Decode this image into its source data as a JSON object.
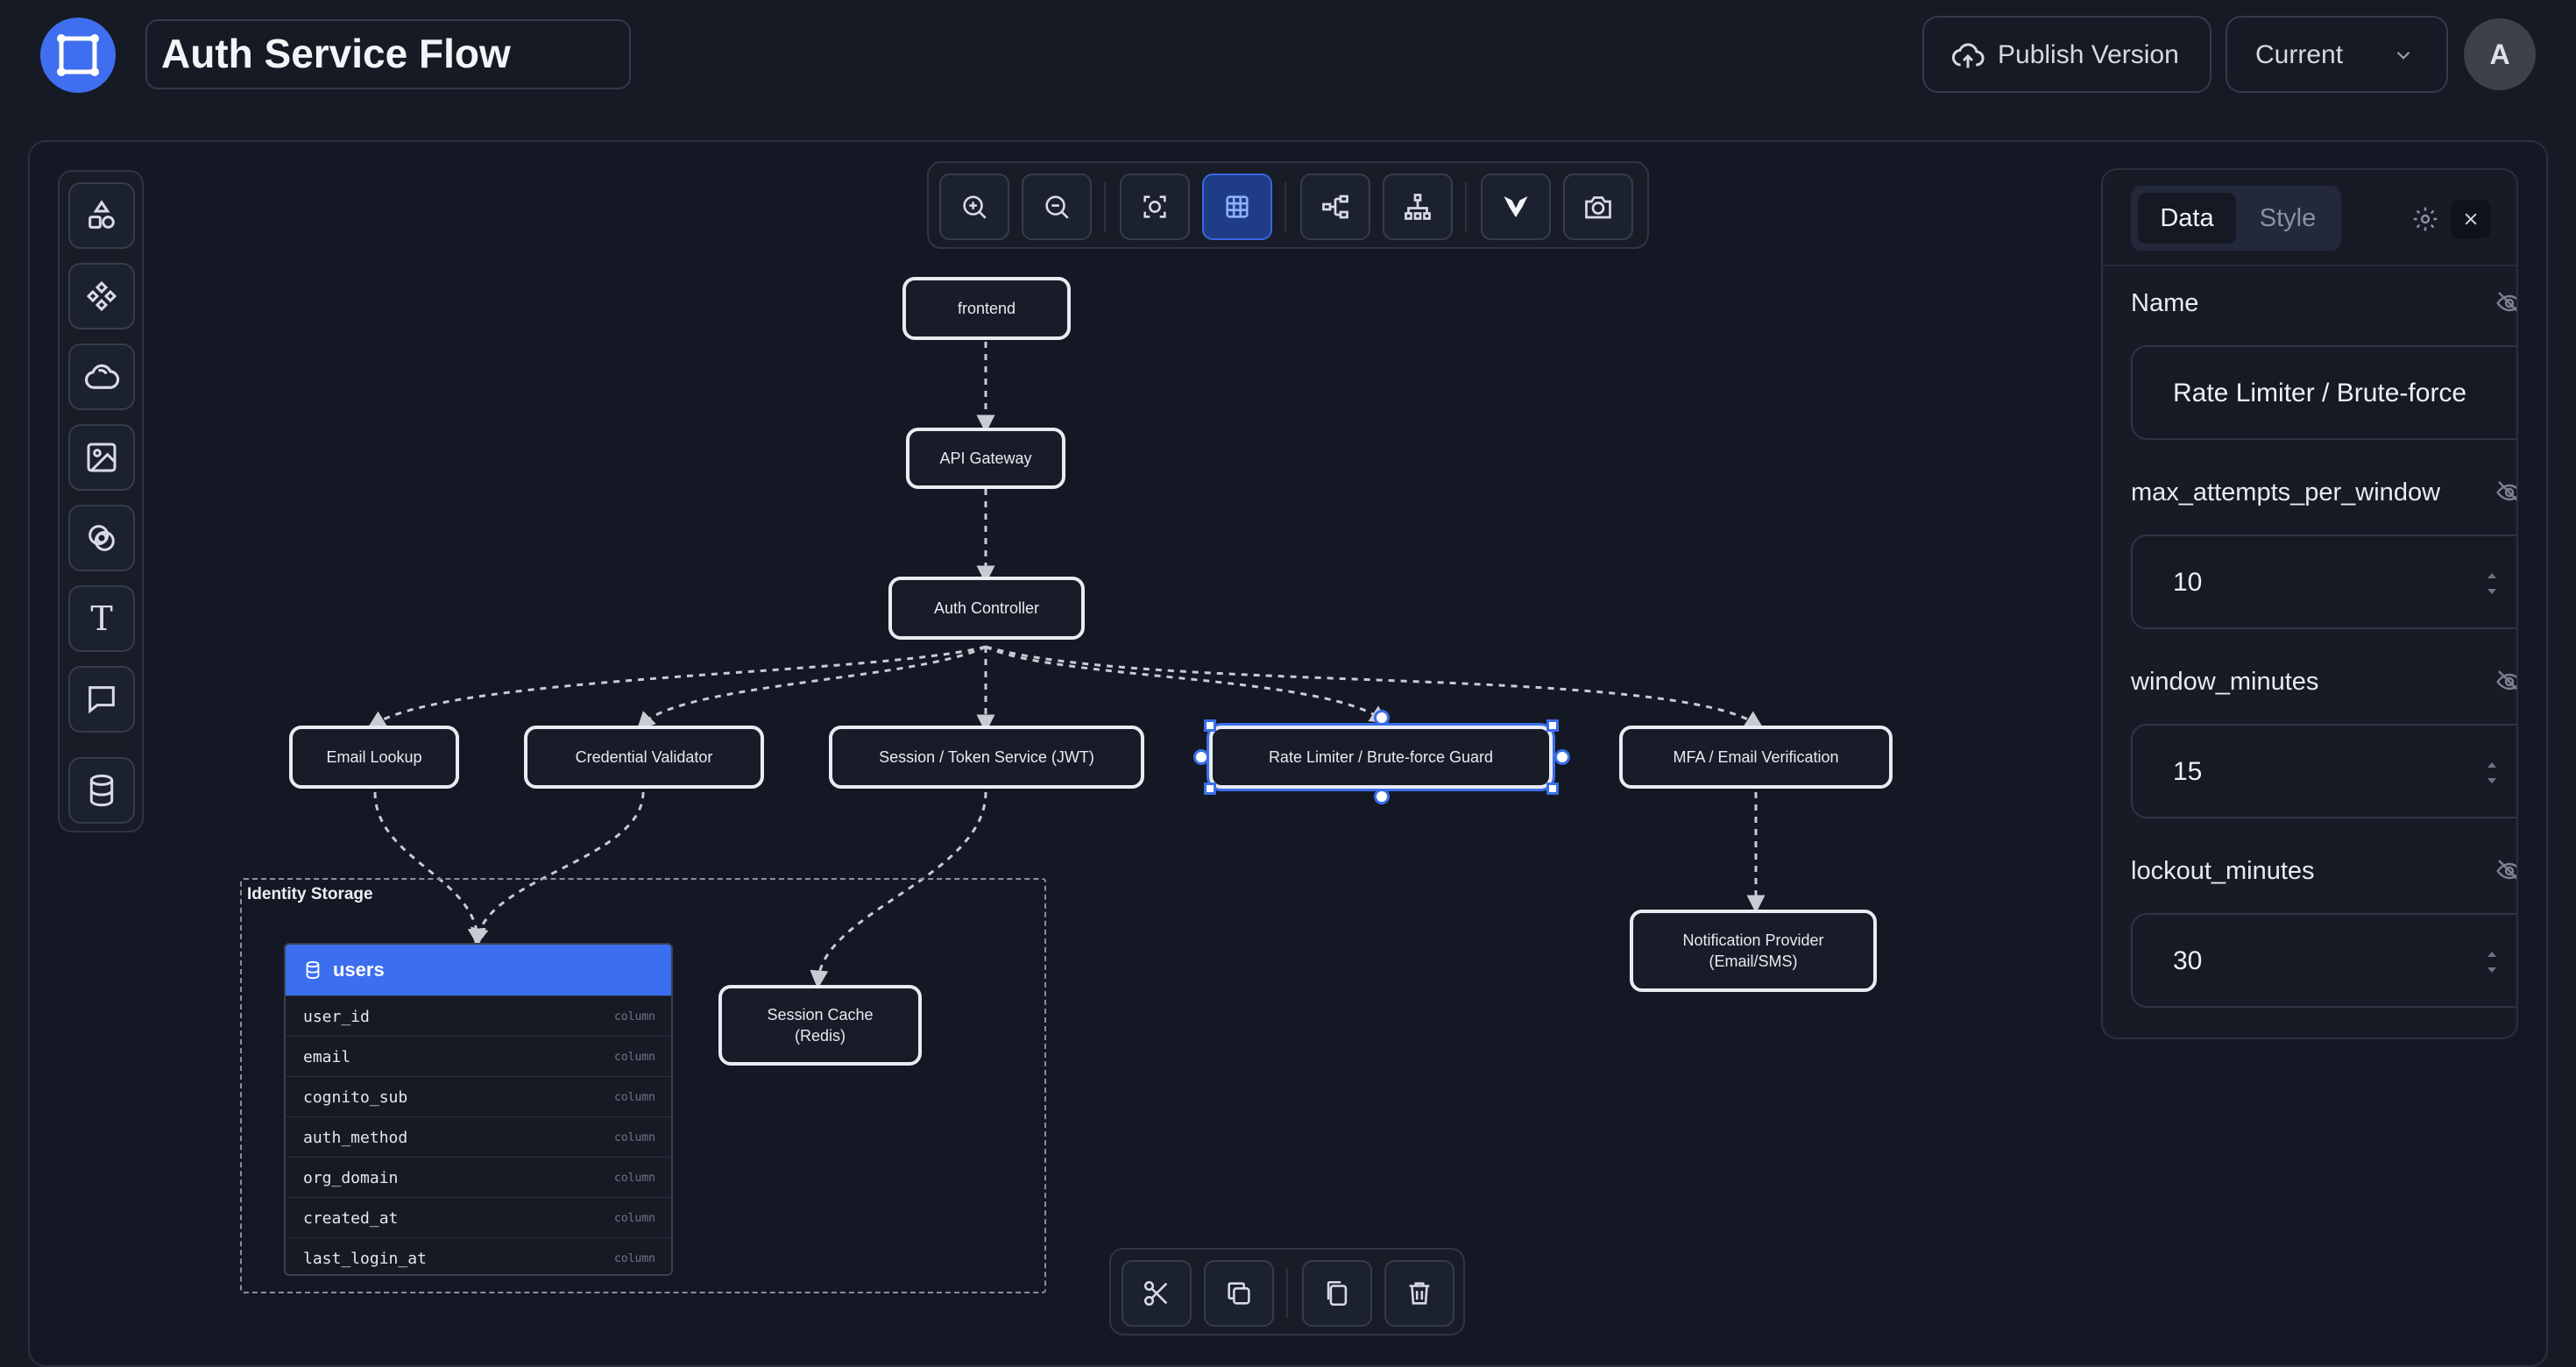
{
  "header": {
    "title": "Auth Service Flow",
    "publish_label": "Publish Version",
    "version_select": "Current",
    "avatar_initial": "A"
  },
  "left_toolbar": [
    {
      "icon": "shapes-icon"
    },
    {
      "icon": "components-icon"
    },
    {
      "icon": "cloud-icon"
    },
    {
      "icon": "image-icon"
    },
    {
      "icon": "link-icon"
    },
    {
      "icon": "text-icon",
      "glyph": "T"
    },
    {
      "icon": "comment-icon"
    },
    {
      "icon": "database-icon"
    }
  ],
  "top_toolbar": [
    {
      "icon": "zoom-in-icon"
    },
    {
      "icon": "zoom-out-icon"
    },
    {
      "icon": "fit-view-icon"
    },
    {
      "icon": "grid-icon",
      "active": true
    },
    {
      "icon": "layout-horizontal-icon"
    },
    {
      "icon": "layout-tree-icon"
    },
    {
      "icon": "logo-icon"
    },
    {
      "icon": "camera-icon"
    }
  ],
  "bottom_toolbar": [
    {
      "icon": "cut-icon"
    },
    {
      "icon": "copy-icon"
    },
    {
      "icon": "paste-icon"
    },
    {
      "icon": "delete-icon"
    }
  ],
  "diagram": {
    "nodes": {
      "frontend": "frontend",
      "api_gateway": "API Gateway",
      "auth_controller": "Auth Controller",
      "email_lookup": "Email Lookup",
      "credential_validator": "Credential Validator",
      "session_token": "Session / Token Service (JWT)",
      "rate_limiter": "Rate Limiter / Brute-force Guard",
      "mfa": "MFA / Email Verification",
      "session_cache": "Session Cache\n(Redis)",
      "notification": "Notification Provider\n(Email/SMS)"
    },
    "group_label": "Identity Storage",
    "table": {
      "name": "users",
      "columns": [
        {
          "name": "user_id",
          "type": "column"
        },
        {
          "name": "email",
          "type": "column"
        },
        {
          "name": "cognito_sub",
          "type": "column"
        },
        {
          "name": "auth_method",
          "type": "column"
        },
        {
          "name": "org_domain",
          "type": "column"
        },
        {
          "name": "created_at",
          "type": "column"
        },
        {
          "name": "last_login_at",
          "type": "column"
        }
      ]
    }
  },
  "panel": {
    "tab_data": "Data",
    "tab_style": "Style",
    "fields": [
      {
        "label": "Name",
        "value": "Rate Limiter / Brute-force"
      },
      {
        "label": "max_attempts_per_window",
        "value": "10"
      },
      {
        "label": "window_minutes",
        "value": "15"
      },
      {
        "label": "lockout_minutes",
        "value": "30"
      }
    ]
  },
  "colors": {
    "background": "#161a25",
    "accent": "#3c6ef0",
    "node_border": "#e9ebf1"
  }
}
